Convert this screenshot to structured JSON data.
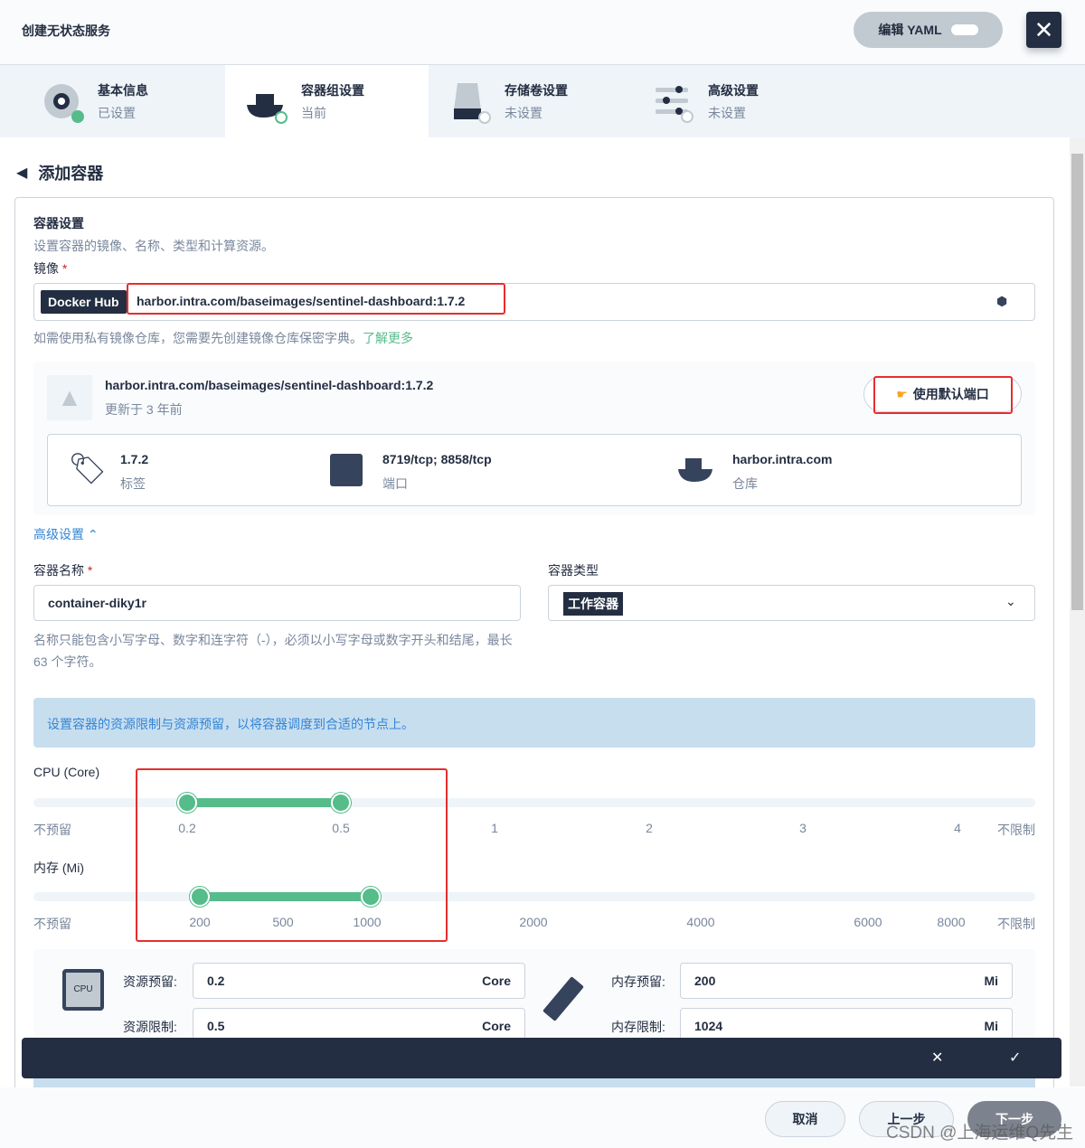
{
  "header": {
    "title": "创建无状态服务",
    "edit_yaml": "编辑 YAML"
  },
  "steps": [
    {
      "title": "基本信息",
      "status": "已设置"
    },
    {
      "title": "容器组设置",
      "status": "当前"
    },
    {
      "title": "存储卷设置",
      "status": "未设置"
    },
    {
      "title": "高级设置",
      "status": "未设置"
    }
  ],
  "page": {
    "title": "添加容器"
  },
  "container": {
    "section_title": "容器设置",
    "section_desc": "设置容器的镜像、名称、类型和计算资源。",
    "image_label": "镜像",
    "registry": "Docker Hub",
    "image_value": "harbor.intra.com/baseimages/sentinel-dashboard:1.7.2",
    "image_hint": "如需使用私有镜像仓库，您需要先创建镜像仓库保密字典。",
    "learn_more": "了解更多",
    "image_card": {
      "name": "harbor.intra.com/baseimages/sentinel-dashboard:1.7.2",
      "updated": "更新于 3 年前",
      "default_ports": "使用默认端口",
      "tag": "1.7.2",
      "tag_label": "标签",
      "ports": "8719/tcp; 8858/tcp",
      "ports_label": "端口",
      "registry": "harbor.intra.com",
      "registry_label": "仓库"
    },
    "advanced": "高级设置",
    "name_label": "容器名称",
    "name_value": "container-diky1r",
    "name_hint": "名称只能包含小写字母、数字和连字符（-），必须以小写字母或数字开头和结尾，最长 63 个字符。",
    "type_label": "容器类型",
    "type_value": "工作容器"
  },
  "resources": {
    "info": "设置容器的资源限制与资源预留，以将容器调度到合适的节点上。",
    "cpu_label": "CPU (Core)",
    "cpu_ticks": [
      "不预留",
      "0.2",
      "0.5",
      "1",
      "2",
      "3",
      "4",
      "不限制"
    ],
    "cpu_range": [
      0.2,
      0.5
    ],
    "mem_label": "内存 (Mi)",
    "mem_ticks": [
      "不预留",
      "200",
      "500",
      "1000",
      "2000",
      "4000",
      "6000",
      "8000",
      "不限制"
    ],
    "mem_range": [
      200,
      1000
    ],
    "cpu_request_label": "资源预留:",
    "cpu_request": "0.2",
    "cpu_limit_label": "资源限制:",
    "cpu_limit": "0.5",
    "cpu_unit": "Core",
    "mem_request_label": "内存预留:",
    "mem_request": "200",
    "mem_limit_label": "内存限制:",
    "mem_limit": "1024",
    "mem_unit": "Mi",
    "cpu_chip": "CPU"
  },
  "footer": {
    "cancel": "取消",
    "prev": "上一步",
    "next": "下一步"
  },
  "watermark": "CSDN @上海运维Q先生",
  "colors": {
    "accent": "#55bc8a",
    "dark": "#242e42",
    "link": "#3385d6"
  }
}
